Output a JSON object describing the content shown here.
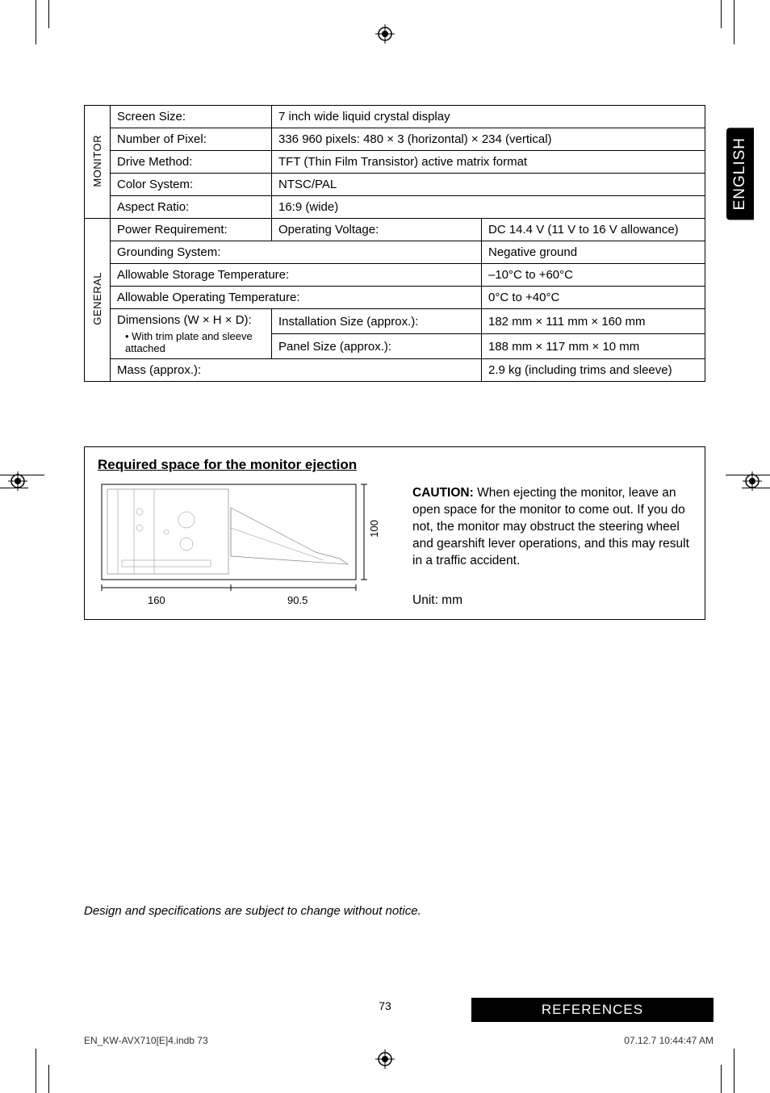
{
  "language_tab": "ENGLISH",
  "spec_table": {
    "section_monitor": "MONITOR",
    "section_general": "GENERAL",
    "rows": {
      "screen_size_label": "Screen Size:",
      "screen_size_value": "7 inch wide liquid crystal display",
      "pixel_label": "Number of Pixel:",
      "pixel_value": "336 960 pixels: 480 × 3 (horizontal) × 234 (vertical)",
      "drive_label": "Drive Method:",
      "drive_value": "TFT (Thin Film Transistor) active matrix format",
      "color_label": "Color System:",
      "color_value": "NTSC/PAL",
      "aspect_label": "Aspect Ratio:",
      "aspect_value": "16:9 (wide)",
      "power_label": "Power Requirement:",
      "operating_voltage_label": "Operating Voltage:",
      "operating_voltage_value": "DC 14.4 V (11 V to 16 V allowance)",
      "grounding_label": "Grounding System:",
      "grounding_value": "Negative ground",
      "storage_temp_label": "Allowable Storage Temperature:",
      "storage_temp_value": "–10°C to +60°C",
      "operating_temp_label": "Allowable Operating Temperature:",
      "operating_temp_value": "0°C to +40°C",
      "dimensions_label": "Dimensions (W × H × D):",
      "dimensions_sub": "• With trim plate and sleeve attached",
      "install_size_label": "Installation Size (approx.):",
      "install_size_value": "182 mm × 111 mm × 160 mm",
      "panel_size_label": "Panel Size (approx.):",
      "panel_size_value": "188 mm × 117 mm × 10 mm",
      "mass_label": "Mass (approx.):",
      "mass_value": "2.9 kg (including trims and sleeve)"
    }
  },
  "required_space": {
    "title": "Required space for the monitor ejection",
    "dim_a": "160",
    "dim_b": "90.5",
    "dim_c": "100",
    "caution_label": "CAUTION:",
    "caution_text": " When ejecting the monitor, leave an open space for the monitor to come out. If you do not, the monitor may obstruct the steering wheel and gearshift lever operations, and this may result in a traffic accident.",
    "unit": "Unit: mm"
  },
  "disclaimer": "Design and specifications are subject to change without notice.",
  "page_number": "73",
  "references_label": "REFERENCES",
  "footer_left": "EN_KW-AVX710[E]4.indb   73",
  "footer_right": "07.12.7   10:44:47 AM"
}
